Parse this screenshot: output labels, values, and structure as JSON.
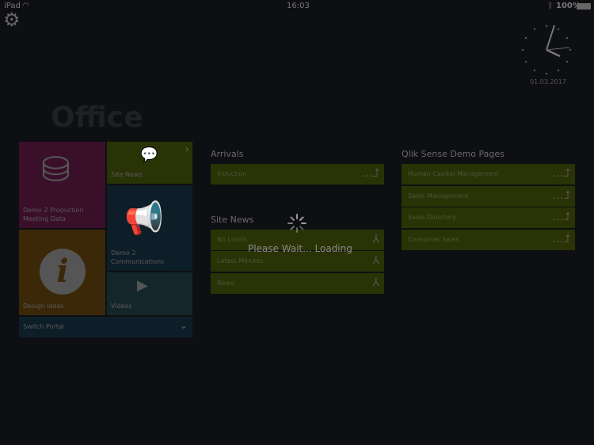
{
  "status_bar": {
    "device": "iPad",
    "time": "16:03",
    "battery": "100%"
  },
  "clock": {
    "date": "01.03.2017"
  },
  "portal": {
    "title": "Office"
  },
  "tiles": [
    {
      "label": "Demo 2 Production Meeting Data",
      "color": "#3a0f2a"
    },
    {
      "label": "Site News",
      "color": "#2a3305"
    },
    {
      "label": "Demo 2 Communications",
      "color": "#0d1e28"
    },
    {
      "label": "Design Ideas",
      "color": "#3a2808"
    },
    {
      "label": "Videos",
      "color": "#15262a"
    }
  ],
  "switch_portal": {
    "label": "Switch Portal"
  },
  "arrivals": {
    "title": "Arrivals",
    "items": [
      "Induction"
    ]
  },
  "site_news": {
    "title": "Site News",
    "items": [
      "No Limits",
      "Latest Minutes",
      "News"
    ]
  },
  "qlik": {
    "title": "Qlik Sense Demo Pages",
    "items": [
      "Human Capital Management",
      "Sales Management",
      "Sales Directory",
      "Consumer Sales"
    ]
  },
  "loading": {
    "text": "Please Wait... Loading"
  }
}
